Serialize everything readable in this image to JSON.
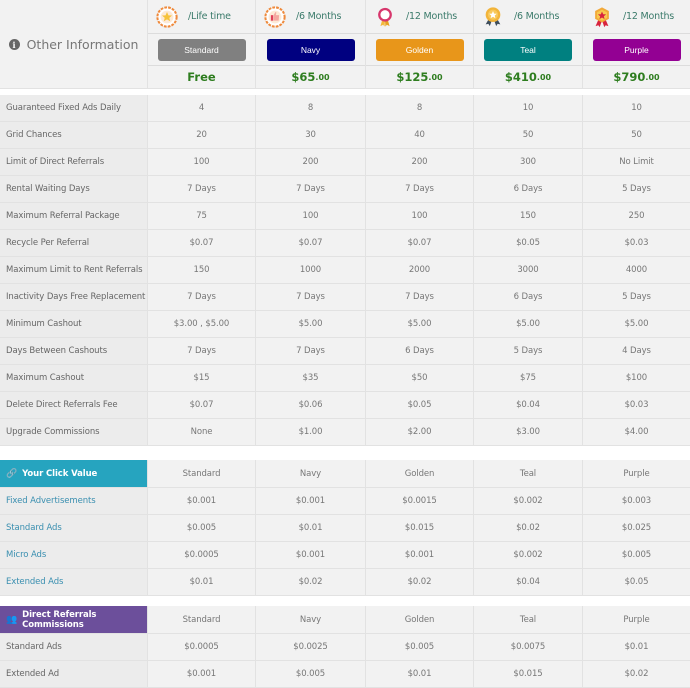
{
  "header": {
    "title": "Other Information",
    "info_icon": "info-circle-icon"
  },
  "plans": [
    {
      "name": "Standard",
      "period": "/Life time",
      "price_main": "Free",
      "price_cents": "",
      "color": "#808080",
      "icon": "star-badge-icon"
    },
    {
      "name": "Navy",
      "period": "/6 Months",
      "price_main": "$65",
      "price_cents": ".00",
      "color": "#000080",
      "icon": "thumbs-up-badge-icon"
    },
    {
      "name": "Golden",
      "period": "/12 Months",
      "price_main": "$125",
      "price_cents": ".00",
      "color": "#e8961a",
      "icon": "ribbon-medal-icon"
    },
    {
      "name": "Teal",
      "period": "/6 Months",
      "price_main": "$410",
      "price_cents": ".00",
      "color": "#008080",
      "icon": "star-medal-icon"
    },
    {
      "name": "Purple",
      "period": "/12 Months",
      "price_main": "$790",
      "price_cents": ".00",
      "color": "#930093",
      "icon": "star-shield-medal-icon"
    }
  ],
  "features": [
    {
      "label": "Guaranteed Fixed Ads Daily",
      "values": [
        "4",
        "8",
        "8",
        "10",
        "10"
      ]
    },
    {
      "label": "Grid Chances",
      "values": [
        "20",
        "30",
        "40",
        "50",
        "50"
      ]
    },
    {
      "label": "Limit of Direct Referrals",
      "values": [
        "100",
        "200",
        "200",
        "300",
        "No Limit"
      ]
    },
    {
      "label": "Rental Waiting Days",
      "values": [
        "7 Days",
        "7 Days",
        "7 Days",
        "6 Days",
        "5 Days"
      ]
    },
    {
      "label": "Maximum Referral Package",
      "values": [
        "75",
        "100",
        "100",
        "150",
        "250"
      ]
    },
    {
      "label": "Recycle Per Referral",
      "values": [
        "$0.07",
        "$0.07",
        "$0.07",
        "$0.05",
        "$0.03"
      ]
    },
    {
      "label": "Maximum Limit to Rent Referrals",
      "values": [
        "150",
        "1000",
        "2000",
        "3000",
        "4000"
      ]
    },
    {
      "label": "Inactivity Days Free Replacement",
      "values": [
        "7 Days",
        "7 Days",
        "7 Days",
        "6 Days",
        "5 Days"
      ]
    },
    {
      "label": "Minimum Cashout",
      "values": [
        "$3.00 , $5.00",
        "$5.00",
        "$5.00",
        "$5.00",
        "$5.00"
      ]
    },
    {
      "label": "Days Between Cashouts",
      "values": [
        "7 Days",
        "7 Days",
        "6 Days",
        "5 Days",
        "4 Days"
      ]
    },
    {
      "label": "Maximum Cashout",
      "values": [
        "$15",
        "$35",
        "$50",
        "$75",
        "$100"
      ]
    },
    {
      "label": "Delete Direct Referrals Fee",
      "values": [
        "$0.07",
        "$0.06",
        "$0.05",
        "$0.04",
        "$0.03"
      ]
    },
    {
      "label": "Upgrade Commissions",
      "values": [
        "None",
        "$1.00",
        "$2.00",
        "$3.00",
        "$4.00"
      ]
    }
  ],
  "click_value": {
    "title": "Your Click Value",
    "icon": "link-icon",
    "color": "#26a4bf",
    "columns": [
      "Standard",
      "Navy",
      "Golden",
      "Teal",
      "Purple"
    ],
    "rows": [
      {
        "label": "Fixed Advertisements",
        "values": [
          "$0.001",
          "$0.001",
          "$0.0015",
          "$0.002",
          "$0.003"
        ]
      },
      {
        "label": "Standard Ads",
        "values": [
          "$0.005",
          "$0.01",
          "$0.015",
          "$0.02",
          "$0.025"
        ]
      },
      {
        "label": "Micro Ads",
        "values": [
          "$0.0005",
          "$0.001",
          "$0.001",
          "$0.002",
          "$0.005"
        ]
      },
      {
        "label": "Extended Ads",
        "values": [
          "$0.01",
          "$0.02",
          "$0.02",
          "$0.04",
          "$0.05"
        ]
      }
    ]
  },
  "referral_commissions": {
    "title": "Direct Referrals Commissions",
    "icon": "users-icon",
    "color": "#6c4f9b",
    "columns": [
      "Standard",
      "Navy",
      "Golden",
      "Teal",
      "Purple"
    ],
    "rows": [
      {
        "label": "Standard Ads",
        "values": [
          "$0.0005",
          "$0.0025",
          "$0.005",
          "$0.0075",
          "$0.01"
        ]
      },
      {
        "label": "Extended Ad",
        "values": [
          "$0.001",
          "$0.005",
          "$0.01",
          "$0.015",
          "$0.02"
        ]
      }
    ]
  }
}
